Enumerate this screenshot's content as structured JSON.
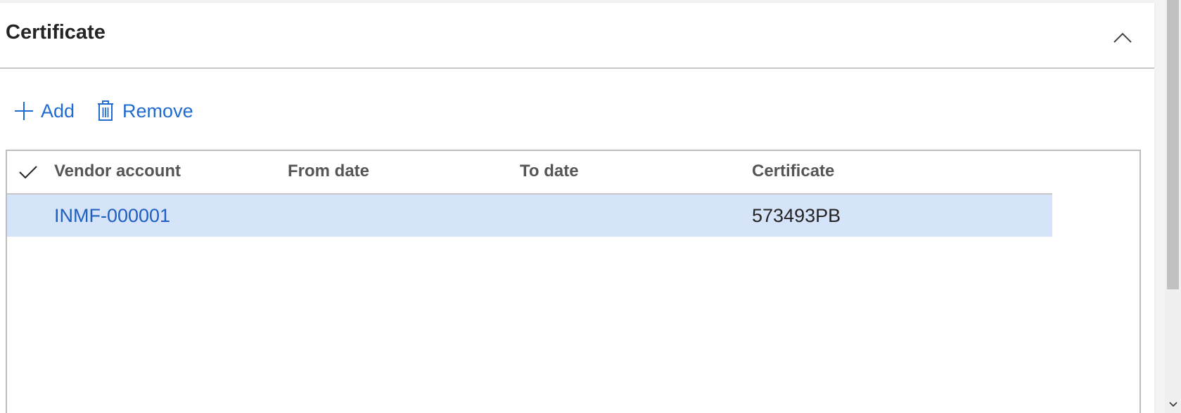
{
  "section": {
    "title": "Certificate",
    "collapse_icon": "chevron-up-icon"
  },
  "toolbar": {
    "add_label": "Add",
    "add_icon": "plus-icon",
    "remove_label": "Remove",
    "remove_icon": "trash-icon"
  },
  "grid": {
    "select_all_icon": "checkmark-icon",
    "columns": [
      "Vendor account",
      "From date",
      "To date",
      "Certificate"
    ],
    "rows": [
      {
        "vendor_account": "INMF-000001",
        "from_date": "",
        "to_date": "",
        "certificate": "573493PB",
        "selected": true
      }
    ]
  },
  "colors": {
    "accent": "#1f6bd1",
    "link": "#1f5fbf",
    "row_selected": "#d6e4f9",
    "header_text": "#555555"
  }
}
